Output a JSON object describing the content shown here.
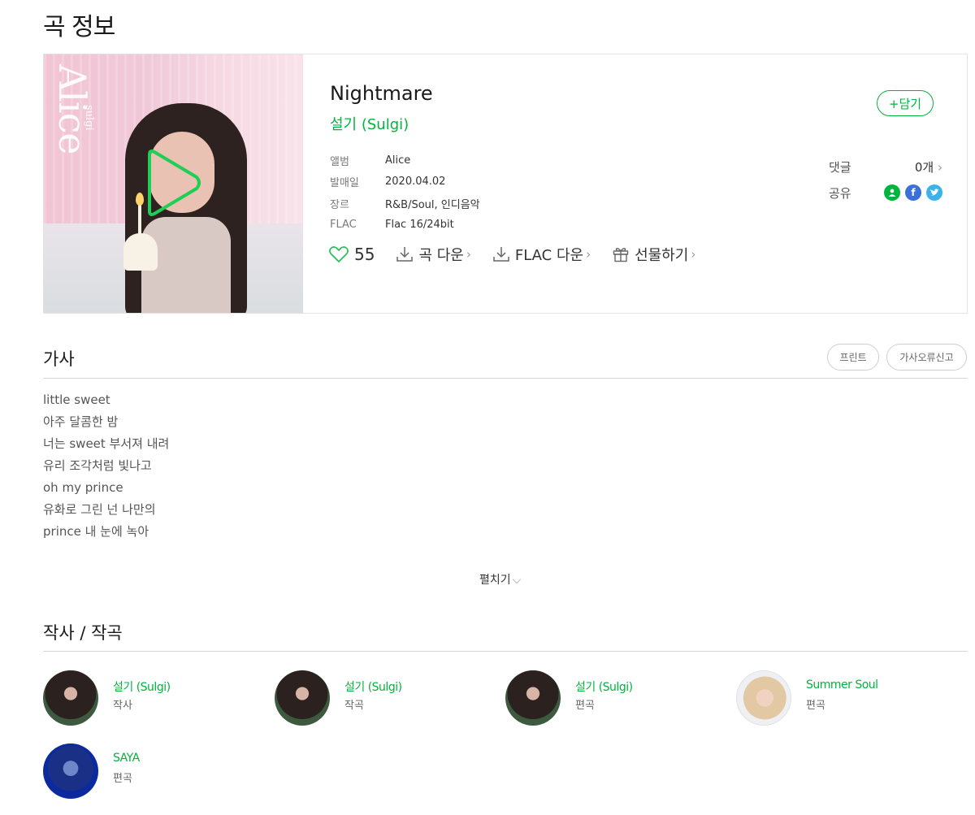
{
  "page_title": "곡 정보",
  "song": {
    "title": "Nightmare",
    "artist": "설기 (Sulgi)",
    "album_art_text": "Alice",
    "album_art_small_text": "sulgi",
    "meta": [
      {
        "label": "앨범",
        "value": "Alice"
      },
      {
        "label": "발매일",
        "value": "2020.04.02"
      },
      {
        "label": "장르",
        "value": "R&B/Soul, 인디음악"
      },
      {
        "label": "FLAC",
        "value": "Flac 16/24bit"
      }
    ],
    "like_count": "55",
    "actions": {
      "song_download": "곡 다운",
      "flac_download": "FLAC 다운",
      "gift": "선물하기"
    },
    "add_button": "+담기",
    "comments_label": "댓글",
    "comments_count": "0개",
    "share_label": "공유"
  },
  "colors": {
    "accent": "#00b43c",
    "facebook": "#3b6fdc",
    "twitter": "#3ab3ea"
  },
  "lyrics": {
    "title": "가사",
    "print_button": "프린트",
    "report_button": "가사오류신고",
    "lines": [
      "little sweet",
      "아주 달콤한 밤",
      "너는 sweet 부서져 내려",
      "유리 조각처럼 빛나고",
      "oh my prince",
      "유화로 그린 넌 나만의",
      "prince 내 눈에 녹아"
    ],
    "expand_label": "펼치기"
  },
  "credits": {
    "title": "작사 / 작곡",
    "people": [
      {
        "name": "설기 (Sulgi)",
        "role": "작사",
        "avatar": "dark"
      },
      {
        "name": "설기 (Sulgi)",
        "role": "작곡",
        "avatar": "dark"
      },
      {
        "name": "설기 (Sulgi)",
        "role": "편곡",
        "avatar": "dark"
      },
      {
        "name": "Summer Soul",
        "role": "편곡",
        "avatar": "light"
      },
      {
        "name": "SAYA",
        "role": "편곡",
        "avatar": "blue"
      }
    ]
  }
}
